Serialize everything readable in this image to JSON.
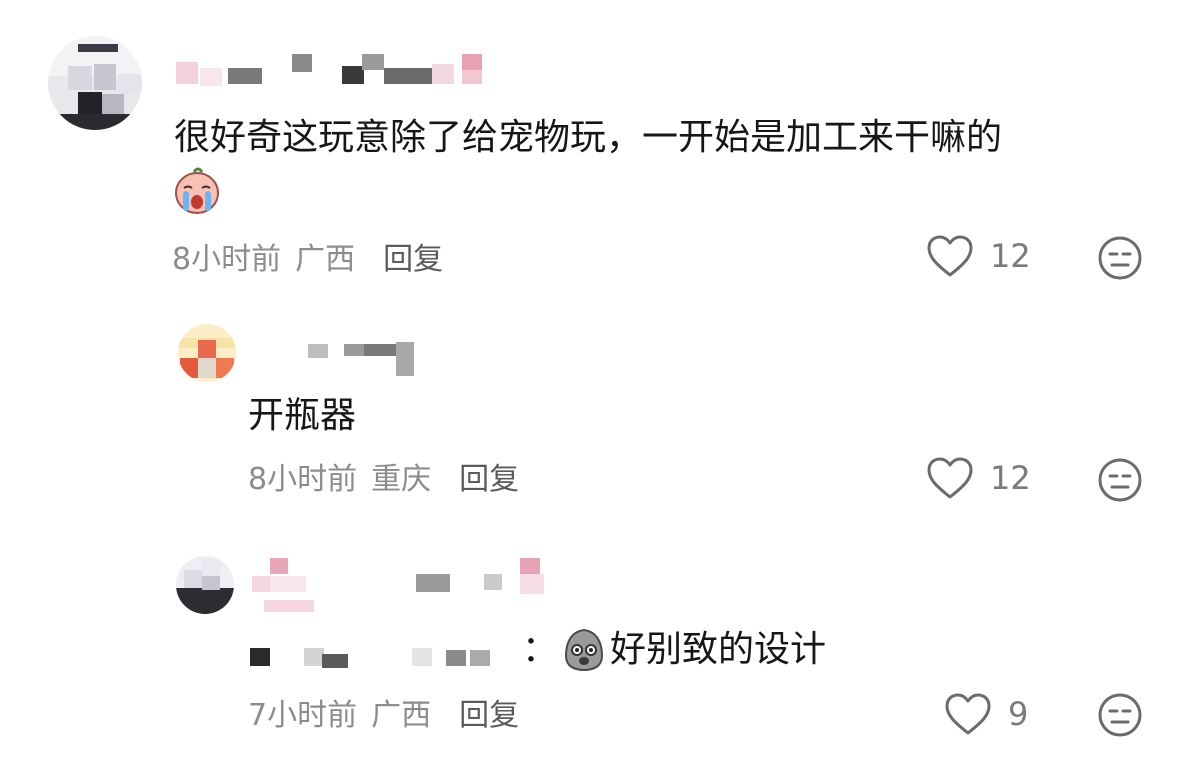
{
  "comments": [
    {
      "text": "很好奇这玩意除了给宠物玩，一开始是加工来干嘛的",
      "emoji": "crying-face-sticker",
      "time": "8小时前",
      "location": "广西",
      "reply_label": "回复",
      "likes": "12",
      "replies": [
        {
          "text": "开瓶器",
          "time": "8小时前",
          "location": "重庆",
          "reply_label": "回复",
          "likes": "12"
        },
        {
          "prefix": "：",
          "emoji": "shocked-blob-sticker",
          "text": "好别致的设计",
          "time": "7小时前",
          "location": "广西",
          "reply_label": "回复",
          "likes": "9"
        }
      ]
    }
  ],
  "icons": {
    "like": "heart-outline-icon",
    "dislike": "neutral-face-icon"
  },
  "colors": {
    "primary_text": "#161616",
    "meta_text": "#8c8c8c",
    "icon_stroke": "#6b6b6b"
  }
}
